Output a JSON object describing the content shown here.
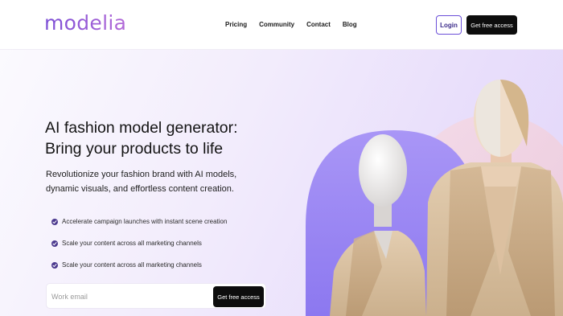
{
  "header": {
    "logo": "modelia",
    "nav": [
      "Pricing",
      "Community",
      "Contact",
      "Blog"
    ],
    "login_label": "Login",
    "cta_label": "Get free access"
  },
  "hero": {
    "title_line1": "AI fashion model generator:",
    "title_line2": "Bring your products to life",
    "subtitle": "Revolutionize your fashion brand with AI models, dynamic visuals, and effortless content creation.",
    "features": [
      "Accelerate campaign launches with instant scene creation",
      "Scale your content across all marketing channels",
      "Scale your content across all marketing channels"
    ],
    "email_placeholder": "Work email",
    "cta_label": "Get free access"
  },
  "colors": {
    "brand_purple": "#8a55d0",
    "button_dark": "#0d0d0d",
    "check_purple": "#4c3a8f",
    "hero_bg_end": "#e2d6fa"
  },
  "icons": {
    "feature_bullet": "check-circle-icon"
  }
}
